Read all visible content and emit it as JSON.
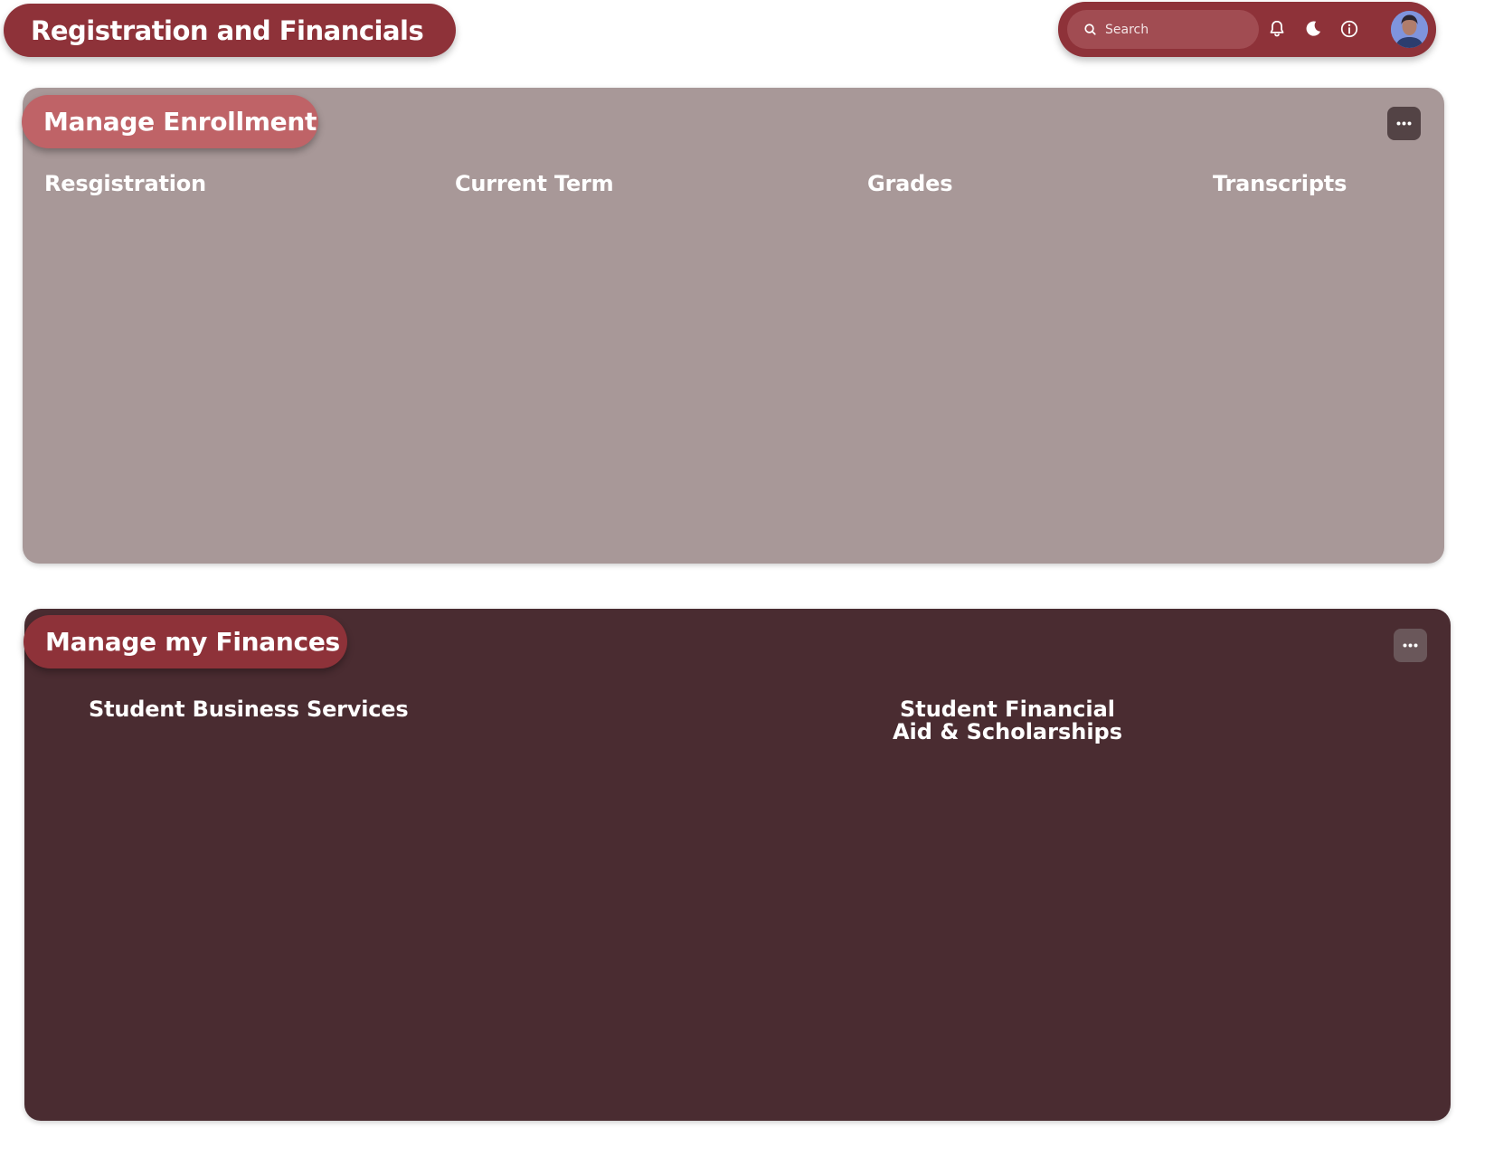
{
  "page": {
    "title": "Registration and Financials"
  },
  "topbar": {
    "search": {
      "placeholder": "Search",
      "value": ""
    },
    "icons": [
      "bell-icon",
      "moon-icon",
      "info-icon",
      "avatar"
    ]
  },
  "enrollment": {
    "title": "Manage Enrollment",
    "sections": [
      {
        "label": "Resgistration"
      },
      {
        "label": "Current Term"
      },
      {
        "label": "Grades"
      },
      {
        "label": "Transcripts"
      }
    ]
  },
  "finances": {
    "title": "Manage my Finances",
    "sections": [
      {
        "label": "Student Business Services"
      },
      {
        "label_line1": "Student Financial",
        "label_line2": "Aid & Scholarships"
      }
    ]
  },
  "colors": {
    "brand": "#8e3239",
    "enrollment_card": "#a89898",
    "enrollment_pill": "#bf6367",
    "finance_card": "#4a2c31"
  }
}
